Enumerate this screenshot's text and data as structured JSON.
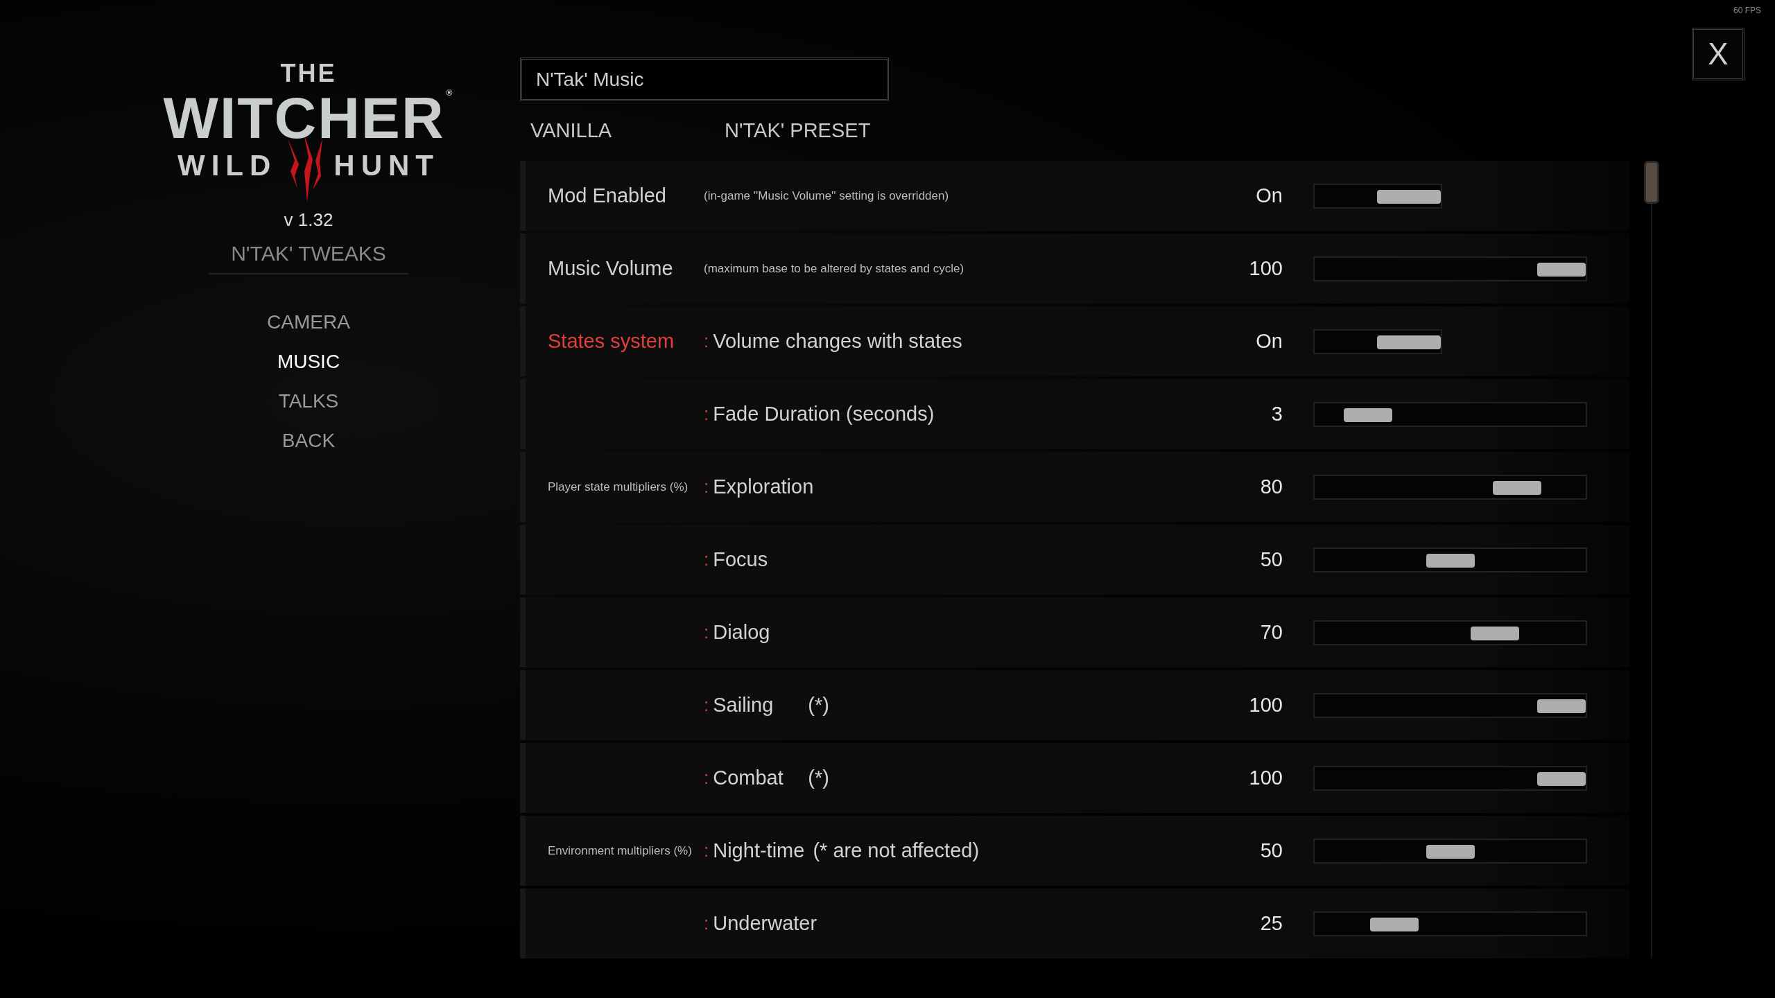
{
  "fps": "60 FPS",
  "logo": {
    "top": "THE",
    "main": "WITCHER",
    "trademark": "®",
    "left": "WILD",
    "right": "HUNT"
  },
  "version": "v 1.32",
  "mod_title": "N'TAK' TWEAKS",
  "menu": [
    {
      "label": "CAMERA",
      "selected": false
    },
    {
      "label": "MUSIC",
      "selected": true
    },
    {
      "label": "TALKS",
      "selected": false
    },
    {
      "label": "BACK",
      "selected": false
    }
  ],
  "search": {
    "value": "N'Tak' Music"
  },
  "presets": [
    {
      "label": "VANILLA"
    },
    {
      "label": "N'TAK' PRESET"
    }
  ],
  "rows": [
    {
      "label": "Mod Enabled",
      "kind": "title",
      "note": "(in-game ''Music Volume'' setting is overridden)",
      "value": "On",
      "control": {
        "kind": "toggle",
        "on": true
      }
    },
    {
      "label": "Music Volume",
      "kind": "title",
      "note": "(maximum base to be altered by states and cycle)",
      "value": "100",
      "control": {
        "kind": "slider",
        "level": 1
      }
    },
    {
      "label": "States system",
      "kind": "section",
      "marker": ":",
      "setting": "Volume changes with states",
      "value": "On",
      "control": {
        "kind": "toggle",
        "on": true
      }
    },
    {
      "marker": ":",
      "setting": "Fade Duration (seconds)",
      "value": "3",
      "control": {
        "kind": "slider",
        "level": 0.13
      }
    },
    {
      "label": "Player state multipliers (%)",
      "kind": "group",
      "marker": ":",
      "setting": "Exploration",
      "value": "80",
      "control": {
        "kind": "slider",
        "level": 0.8
      }
    },
    {
      "marker": ":",
      "setting": "Focus",
      "value": "50",
      "control": {
        "kind": "slider",
        "level": 0.5
      }
    },
    {
      "marker": ":",
      "setting": "Dialog",
      "value": "70",
      "control": {
        "kind": "slider",
        "level": 0.7
      }
    },
    {
      "marker": ":",
      "setting": "Sailing",
      "suffix": "(*)",
      "value": "100",
      "control": {
        "kind": "slider",
        "level": 1
      }
    },
    {
      "marker": ":",
      "setting": "Combat",
      "suffix": "(*)",
      "value": "100",
      "control": {
        "kind": "slider",
        "level": 1
      }
    },
    {
      "label": "Environment multipliers (%)",
      "kind": "group",
      "marker": ":",
      "setting": "Night-time",
      "suffix": "(* are not affected)",
      "value": "50",
      "control": {
        "kind": "slider",
        "level": 0.5
      }
    },
    {
      "marker": ":",
      "setting": "Underwater",
      "value": "25",
      "control": {
        "kind": "slider",
        "level": 0.25
      }
    }
  ],
  "close": {
    "label": "X"
  }
}
